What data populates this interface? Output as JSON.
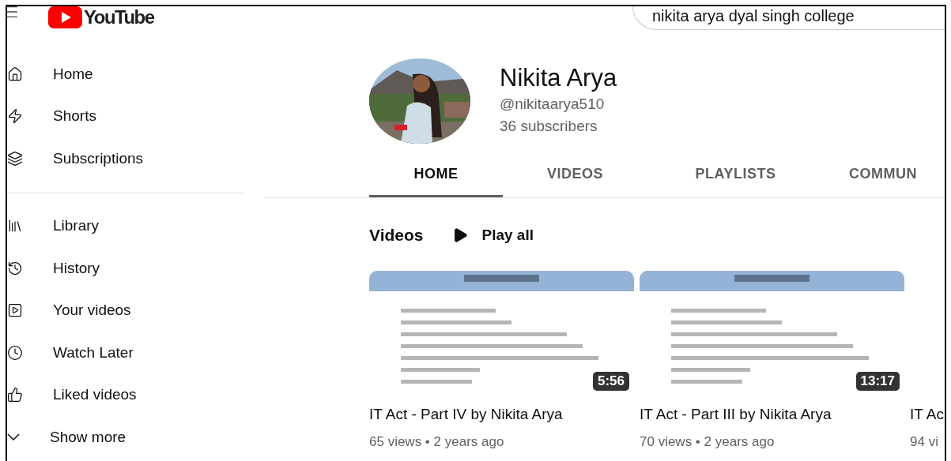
{
  "header": {
    "logo_text": "YouTube",
    "search": {
      "value": "nikita arya dyal singh college"
    }
  },
  "sidebar": {
    "sections": [
      {
        "items": [
          {
            "label": "Home",
            "selected": false
          },
          {
            "label": "Shorts",
            "selected": false
          },
          {
            "label": "Subscriptions",
            "selected": false
          }
        ]
      },
      {
        "items": [
          {
            "label": "Library",
            "selected": false
          },
          {
            "label": "History",
            "selected": false
          },
          {
            "label": "Your videos",
            "selected": false
          },
          {
            "label": "Watch Later",
            "selected": false
          },
          {
            "label": "Liked videos",
            "selected": false
          },
          {
            "label": "Show more",
            "selected": false
          }
        ]
      }
    ]
  },
  "channel": {
    "name": "Nikita Arya",
    "handle": "@nikitaarya510",
    "subscribers": "36 subscribers"
  },
  "tabs": [
    {
      "label": "HOME",
      "selected": true
    },
    {
      "label": "VIDEOS",
      "selected": false
    },
    {
      "label": "PLAYLISTS",
      "selected": false
    },
    {
      "label": "COMMUN",
      "selected": false
    }
  ],
  "videos_section": {
    "title": "Videos",
    "play_all": "Play all",
    "videos": [
      {
        "duration": "5:56",
        "title": "IT Act - Part IV by Nikita Arya",
        "meta": "65 views • 2 years ago"
      },
      {
        "duration": "13:17",
        "title": "IT Act - Part III by Nikita Arya",
        "meta": "70 views • 2 years ago"
      },
      {
        "title": "IT Ac",
        "meta": "94 vi"
      }
    ]
  }
}
